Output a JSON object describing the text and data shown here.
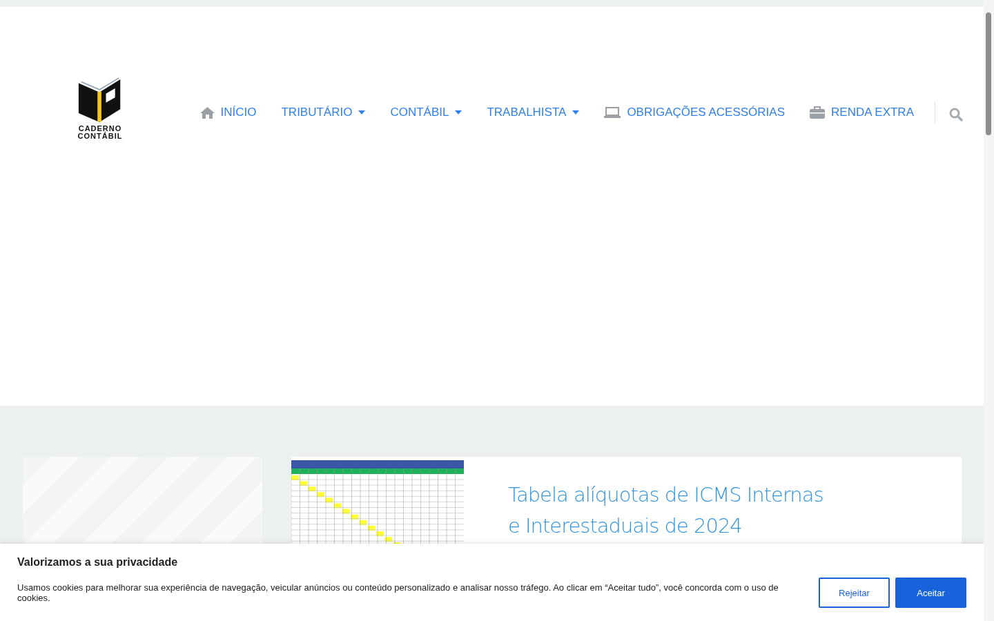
{
  "logo": {
    "lines": [
      "CADERNO",
      "CONTÁBIL"
    ]
  },
  "nav": [
    {
      "label": "INÍCIO",
      "kind": "home"
    },
    {
      "label": "TRIBUTÁRIO",
      "kind": "dropdown"
    },
    {
      "label": "CONTÁBIL",
      "kind": "dropdown"
    },
    {
      "label": "TRABALHISTA",
      "kind": "dropdown"
    },
    {
      "label": "OBRIGAÇÕES ACESSÓRIAS",
      "kind": "laptop"
    },
    {
      "label": "RENDA EXTRA",
      "kind": "briefcase"
    }
  ],
  "post": {
    "title": "Tabela alíquotas de ICMS Internas e Interestaduais de 2024"
  },
  "cookie_banner": {
    "title": "Valorizamos a sua privacidade",
    "text": "Usamos cookies para melhorar sua experiência de navegação, veicular anúncios ou conteúdo personalizado e analisar nosso tráfego. Ao clicar em “Aceitar tudo”, você concorda com o uso de cookies.",
    "buttons": [
      {
        "label": "Rejeitar",
        "kind": "secondary"
      },
      {
        "label": "Aceitar",
        "kind": "primary"
      }
    ]
  }
}
